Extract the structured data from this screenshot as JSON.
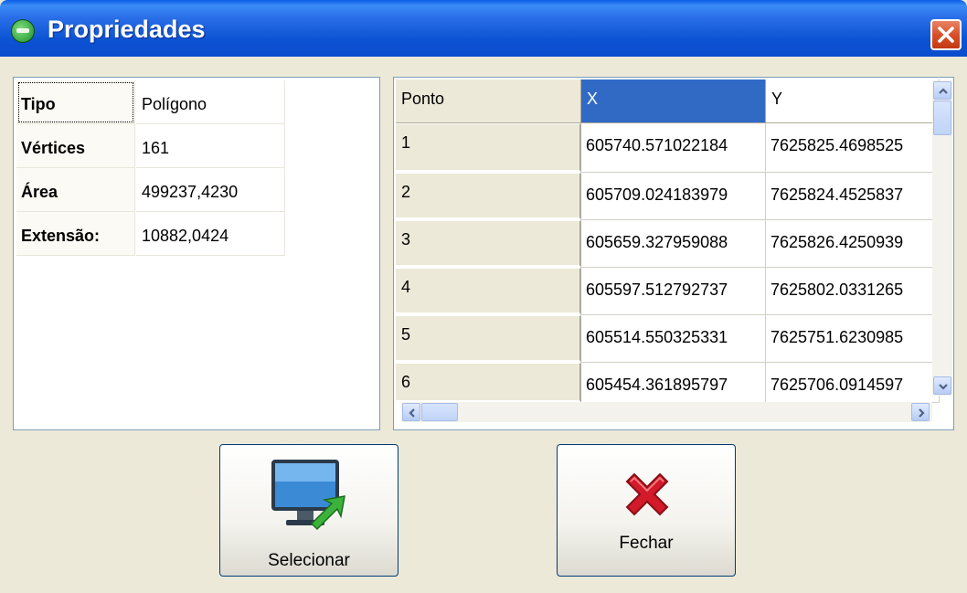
{
  "window": {
    "title": "Propriedades",
    "icon": "app-globe-icon",
    "close": "close-icon"
  },
  "properties": [
    {
      "key": "Tipo",
      "value": "Polígono"
    },
    {
      "key": "Vértices",
      "value": "161"
    },
    {
      "key": "Área",
      "value": "499237,4230"
    },
    {
      "key": "Extensão:",
      "value": "10882,0424"
    }
  ],
  "grid": {
    "columns": [
      "Ponto",
      "X",
      "Y"
    ],
    "selected_column": "X",
    "rows": [
      {
        "ponto": "1",
        "x": "605740.571022184",
        "y": "7625825.4698525"
      },
      {
        "ponto": "2",
        "x": "605709.024183979",
        "y": "7625824.4525837"
      },
      {
        "ponto": "3",
        "x": "605659.327959088",
        "y": "7625826.4250939"
      },
      {
        "ponto": "4",
        "x": "605597.512792737",
        "y": "7625802.0331265"
      },
      {
        "ponto": "5",
        "x": "605514.550325331",
        "y": "7625751.6230985"
      },
      {
        "ponto": "6",
        "x": "605454.361895797",
        "y": "7625706.0914597"
      }
    ]
  },
  "buttons": {
    "select_label": "Selecionar",
    "close_label": "Fechar"
  },
  "colors": {
    "titlebar": "#0b4ccd",
    "selection": "#316ac5",
    "close_x": "#c8102e"
  }
}
